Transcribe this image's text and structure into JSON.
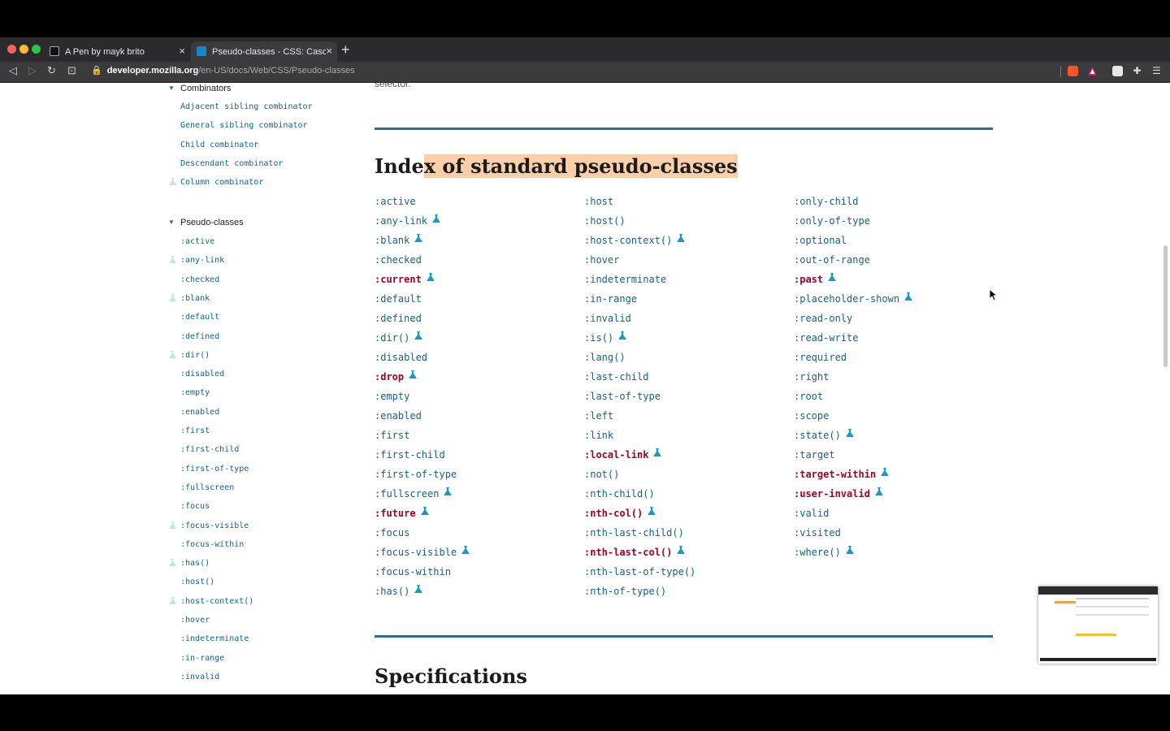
{
  "browser": {
    "tabs": [
      {
        "title": "A Pen by mayk brito",
        "close": "×"
      },
      {
        "title": "Pseudo-classes - CSS: Cascadin",
        "close": "×"
      }
    ],
    "new_tab": "+",
    "url_host": "developer.mozilla.org",
    "url_path": "/en-US/docs/Web/CSS/Pseudo-classes",
    "nav": {
      "back": "◁",
      "forward": "▷",
      "reload": "↻",
      "bookmark": "⊡"
    },
    "colors": {
      "chrome": "#2b2b2d",
      "toolbar": "#3b3b3e"
    }
  },
  "sidebar": {
    "groups": [
      {
        "label": "Combinators",
        "items": [
          {
            "label": "Adjacent sibling combinator",
            "experimental": false
          },
          {
            "label": "General sibling combinator",
            "experimental": false
          },
          {
            "label": "Child combinator",
            "experimental": false
          },
          {
            "label": "Descendant combinator",
            "experimental": false
          },
          {
            "label": "Column combinator",
            "experimental": true
          }
        ]
      },
      {
        "label": "Pseudo-classes",
        "items": [
          {
            "label": ":active",
            "experimental": false
          },
          {
            "label": ":any-link",
            "experimental": true
          },
          {
            "label": ":checked",
            "experimental": false
          },
          {
            "label": ":blank",
            "experimental": true
          },
          {
            "label": ":default",
            "experimental": false
          },
          {
            "label": ":defined",
            "experimental": false
          },
          {
            "label": ":dir()",
            "experimental": true
          },
          {
            "label": ":disabled",
            "experimental": false
          },
          {
            "label": ":empty",
            "experimental": false
          },
          {
            "label": ":enabled",
            "experimental": false
          },
          {
            "label": ":first",
            "experimental": false
          },
          {
            "label": ":first-child",
            "experimental": false
          },
          {
            "label": ":first-of-type",
            "experimental": false
          },
          {
            "label": ":fullscreen",
            "experimental": false
          },
          {
            "label": ":focus",
            "experimental": false
          },
          {
            "label": ":focus-visible",
            "experimental": true
          },
          {
            "label": ":focus-within",
            "experimental": false
          },
          {
            "label": ":has()",
            "experimental": true
          },
          {
            "label": ":host()",
            "experimental": false
          },
          {
            "label": ":host-context()",
            "experimental": true
          },
          {
            "label": ":hover",
            "experimental": false
          },
          {
            "label": ":indeterminate",
            "experimental": false
          },
          {
            "label": ":in-range",
            "experimental": false
          },
          {
            "label": ":invalid",
            "experimental": false
          }
        ]
      }
    ]
  },
  "main": {
    "cutoff_text": "selector.",
    "index_heading_plain": "Inde",
    "index_heading_highlighted": "x of standard pseudo-classes",
    "spec_heading": "Specifications",
    "colors": {
      "link": "#0c6590",
      "missing_link": "#a3002a",
      "rule": "#2a6f8d",
      "highlight": "#f8cfa9",
      "flask": "#1599c5"
    },
    "columns": [
      [
        {
          "label": ":active",
          "experimental": false,
          "missing": false
        },
        {
          "label": ":any-link",
          "experimental": true,
          "missing": false
        },
        {
          "label": ":blank",
          "experimental": true,
          "missing": false
        },
        {
          "label": ":checked",
          "experimental": false,
          "missing": false
        },
        {
          "label": ":current",
          "experimental": true,
          "missing": true
        },
        {
          "label": ":default",
          "experimental": false,
          "missing": false
        },
        {
          "label": ":defined",
          "experimental": false,
          "missing": false
        },
        {
          "label": ":dir()",
          "experimental": true,
          "missing": false
        },
        {
          "label": ":disabled",
          "experimental": false,
          "missing": false
        },
        {
          "label": ":drop",
          "experimental": true,
          "missing": true
        },
        {
          "label": ":empty",
          "experimental": false,
          "missing": false
        },
        {
          "label": ":enabled",
          "experimental": false,
          "missing": false
        },
        {
          "label": ":first",
          "experimental": false,
          "missing": false
        },
        {
          "label": ":first-child",
          "experimental": false,
          "missing": false
        },
        {
          "label": ":first-of-type",
          "experimental": false,
          "missing": false
        },
        {
          "label": ":fullscreen",
          "experimental": true,
          "missing": false
        },
        {
          "label": ":future",
          "experimental": true,
          "missing": true
        },
        {
          "label": ":focus",
          "experimental": false,
          "missing": false
        },
        {
          "label": ":focus-visible",
          "experimental": true,
          "missing": false
        },
        {
          "label": ":focus-within",
          "experimental": false,
          "missing": false
        },
        {
          "label": ":has()",
          "experimental": true,
          "missing": false
        }
      ],
      [
        {
          "label": ":host",
          "experimental": false,
          "missing": false
        },
        {
          "label": ":host()",
          "experimental": false,
          "missing": false
        },
        {
          "label": ":host-context()",
          "experimental": true,
          "missing": false
        },
        {
          "label": ":hover",
          "experimental": false,
          "missing": false
        },
        {
          "label": ":indeterminate",
          "experimental": false,
          "missing": false
        },
        {
          "label": ":in-range",
          "experimental": false,
          "missing": false
        },
        {
          "label": ":invalid",
          "experimental": false,
          "missing": false
        },
        {
          "label": ":is()",
          "experimental": true,
          "missing": false
        },
        {
          "label": ":lang()",
          "experimental": false,
          "missing": false
        },
        {
          "label": ":last-child",
          "experimental": false,
          "missing": false
        },
        {
          "label": ":last-of-type",
          "experimental": false,
          "missing": false
        },
        {
          "label": ":left",
          "experimental": false,
          "missing": false
        },
        {
          "label": ":link",
          "experimental": false,
          "missing": false
        },
        {
          "label": ":local-link",
          "experimental": true,
          "missing": true
        },
        {
          "label": ":not()",
          "experimental": false,
          "missing": false
        },
        {
          "label": ":nth-child()",
          "experimental": false,
          "missing": false
        },
        {
          "label": ":nth-col()",
          "experimental": true,
          "missing": true
        },
        {
          "label": ":nth-last-child()",
          "experimental": false,
          "missing": false
        },
        {
          "label": ":nth-last-col()",
          "experimental": true,
          "missing": true
        },
        {
          "label": ":nth-last-of-type()",
          "experimental": false,
          "missing": false
        },
        {
          "label": ":nth-of-type()",
          "experimental": false,
          "missing": false
        }
      ],
      [
        {
          "label": ":only-child",
          "experimental": false,
          "missing": false
        },
        {
          "label": ":only-of-type",
          "experimental": false,
          "missing": false
        },
        {
          "label": ":optional",
          "experimental": false,
          "missing": false
        },
        {
          "label": ":out-of-range",
          "experimental": false,
          "missing": false
        },
        {
          "label": ":past",
          "experimental": true,
          "missing": true
        },
        {
          "label": ":placeholder-shown",
          "experimental": true,
          "missing": false
        },
        {
          "label": ":read-only",
          "experimental": false,
          "missing": false
        },
        {
          "label": ":read-write",
          "experimental": false,
          "missing": false
        },
        {
          "label": ":required",
          "experimental": false,
          "missing": false
        },
        {
          "label": ":right",
          "experimental": false,
          "missing": false
        },
        {
          "label": ":root",
          "experimental": false,
          "missing": false
        },
        {
          "label": ":scope",
          "experimental": false,
          "missing": false
        },
        {
          "label": ":state()",
          "experimental": true,
          "missing": false
        },
        {
          "label": ":target",
          "experimental": false,
          "missing": false
        },
        {
          "label": ":target-within",
          "experimental": true,
          "missing": true
        },
        {
          "label": ":user-invalid",
          "experimental": true,
          "missing": true
        },
        {
          "label": ":valid",
          "experimental": false,
          "missing": false
        },
        {
          "label": ":visited",
          "experimental": false,
          "missing": false
        },
        {
          "label": ":where()",
          "experimental": true,
          "missing": false
        }
      ]
    ]
  }
}
